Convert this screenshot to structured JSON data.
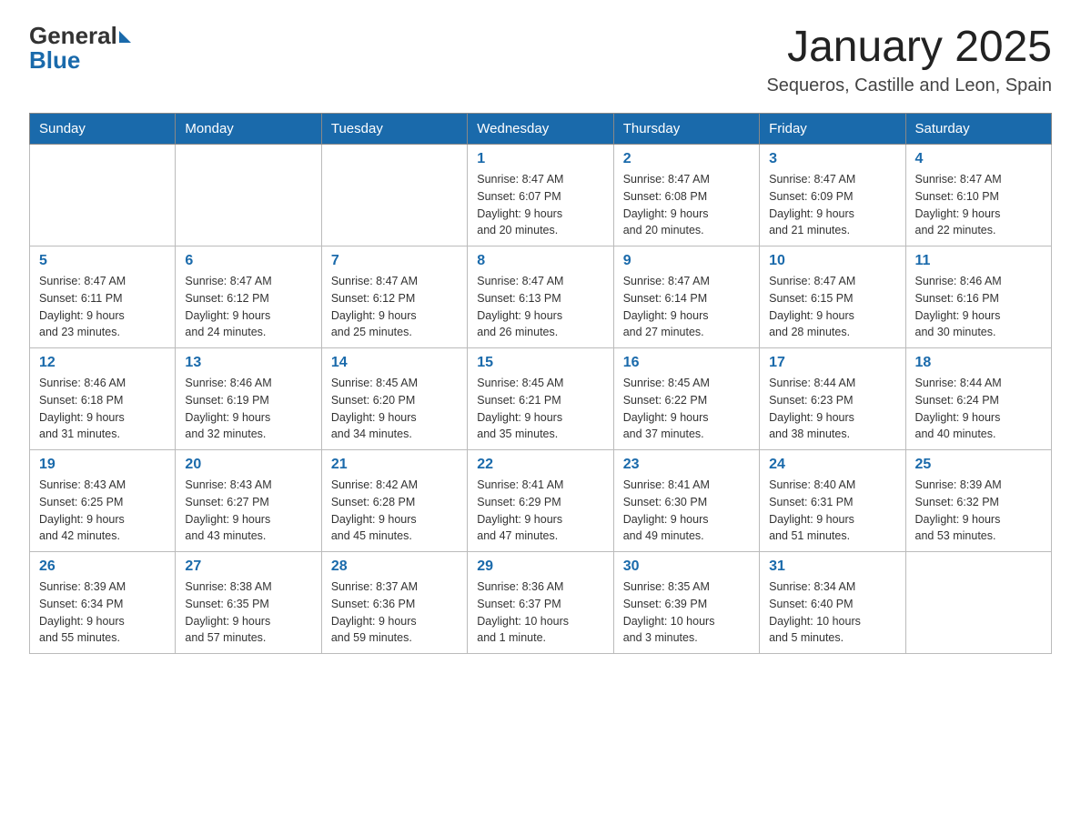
{
  "header": {
    "logo_general": "General",
    "logo_blue": "Blue",
    "title": "January 2025",
    "subtitle": "Sequeros, Castille and Leon, Spain"
  },
  "days_of_week": [
    "Sunday",
    "Monday",
    "Tuesday",
    "Wednesday",
    "Thursday",
    "Friday",
    "Saturday"
  ],
  "weeks": [
    [
      {
        "day": "",
        "info": ""
      },
      {
        "day": "",
        "info": ""
      },
      {
        "day": "",
        "info": ""
      },
      {
        "day": "1",
        "info": "Sunrise: 8:47 AM\nSunset: 6:07 PM\nDaylight: 9 hours\nand 20 minutes."
      },
      {
        "day": "2",
        "info": "Sunrise: 8:47 AM\nSunset: 6:08 PM\nDaylight: 9 hours\nand 20 minutes."
      },
      {
        "day": "3",
        "info": "Sunrise: 8:47 AM\nSunset: 6:09 PM\nDaylight: 9 hours\nand 21 minutes."
      },
      {
        "day": "4",
        "info": "Sunrise: 8:47 AM\nSunset: 6:10 PM\nDaylight: 9 hours\nand 22 minutes."
      }
    ],
    [
      {
        "day": "5",
        "info": "Sunrise: 8:47 AM\nSunset: 6:11 PM\nDaylight: 9 hours\nand 23 minutes."
      },
      {
        "day": "6",
        "info": "Sunrise: 8:47 AM\nSunset: 6:12 PM\nDaylight: 9 hours\nand 24 minutes."
      },
      {
        "day": "7",
        "info": "Sunrise: 8:47 AM\nSunset: 6:12 PM\nDaylight: 9 hours\nand 25 minutes."
      },
      {
        "day": "8",
        "info": "Sunrise: 8:47 AM\nSunset: 6:13 PM\nDaylight: 9 hours\nand 26 minutes."
      },
      {
        "day": "9",
        "info": "Sunrise: 8:47 AM\nSunset: 6:14 PM\nDaylight: 9 hours\nand 27 minutes."
      },
      {
        "day": "10",
        "info": "Sunrise: 8:47 AM\nSunset: 6:15 PM\nDaylight: 9 hours\nand 28 minutes."
      },
      {
        "day": "11",
        "info": "Sunrise: 8:46 AM\nSunset: 6:16 PM\nDaylight: 9 hours\nand 30 minutes."
      }
    ],
    [
      {
        "day": "12",
        "info": "Sunrise: 8:46 AM\nSunset: 6:18 PM\nDaylight: 9 hours\nand 31 minutes."
      },
      {
        "day": "13",
        "info": "Sunrise: 8:46 AM\nSunset: 6:19 PM\nDaylight: 9 hours\nand 32 minutes."
      },
      {
        "day": "14",
        "info": "Sunrise: 8:45 AM\nSunset: 6:20 PM\nDaylight: 9 hours\nand 34 minutes."
      },
      {
        "day": "15",
        "info": "Sunrise: 8:45 AM\nSunset: 6:21 PM\nDaylight: 9 hours\nand 35 minutes."
      },
      {
        "day": "16",
        "info": "Sunrise: 8:45 AM\nSunset: 6:22 PM\nDaylight: 9 hours\nand 37 minutes."
      },
      {
        "day": "17",
        "info": "Sunrise: 8:44 AM\nSunset: 6:23 PM\nDaylight: 9 hours\nand 38 minutes."
      },
      {
        "day": "18",
        "info": "Sunrise: 8:44 AM\nSunset: 6:24 PM\nDaylight: 9 hours\nand 40 minutes."
      }
    ],
    [
      {
        "day": "19",
        "info": "Sunrise: 8:43 AM\nSunset: 6:25 PM\nDaylight: 9 hours\nand 42 minutes."
      },
      {
        "day": "20",
        "info": "Sunrise: 8:43 AM\nSunset: 6:27 PM\nDaylight: 9 hours\nand 43 minutes."
      },
      {
        "day": "21",
        "info": "Sunrise: 8:42 AM\nSunset: 6:28 PM\nDaylight: 9 hours\nand 45 minutes."
      },
      {
        "day": "22",
        "info": "Sunrise: 8:41 AM\nSunset: 6:29 PM\nDaylight: 9 hours\nand 47 minutes."
      },
      {
        "day": "23",
        "info": "Sunrise: 8:41 AM\nSunset: 6:30 PM\nDaylight: 9 hours\nand 49 minutes."
      },
      {
        "day": "24",
        "info": "Sunrise: 8:40 AM\nSunset: 6:31 PM\nDaylight: 9 hours\nand 51 minutes."
      },
      {
        "day": "25",
        "info": "Sunrise: 8:39 AM\nSunset: 6:32 PM\nDaylight: 9 hours\nand 53 minutes."
      }
    ],
    [
      {
        "day": "26",
        "info": "Sunrise: 8:39 AM\nSunset: 6:34 PM\nDaylight: 9 hours\nand 55 minutes."
      },
      {
        "day": "27",
        "info": "Sunrise: 8:38 AM\nSunset: 6:35 PM\nDaylight: 9 hours\nand 57 minutes."
      },
      {
        "day": "28",
        "info": "Sunrise: 8:37 AM\nSunset: 6:36 PM\nDaylight: 9 hours\nand 59 minutes."
      },
      {
        "day": "29",
        "info": "Sunrise: 8:36 AM\nSunset: 6:37 PM\nDaylight: 10 hours\nand 1 minute."
      },
      {
        "day": "30",
        "info": "Sunrise: 8:35 AM\nSunset: 6:39 PM\nDaylight: 10 hours\nand 3 minutes."
      },
      {
        "day": "31",
        "info": "Sunrise: 8:34 AM\nSunset: 6:40 PM\nDaylight: 10 hours\nand 5 minutes."
      },
      {
        "day": "",
        "info": ""
      }
    ]
  ]
}
